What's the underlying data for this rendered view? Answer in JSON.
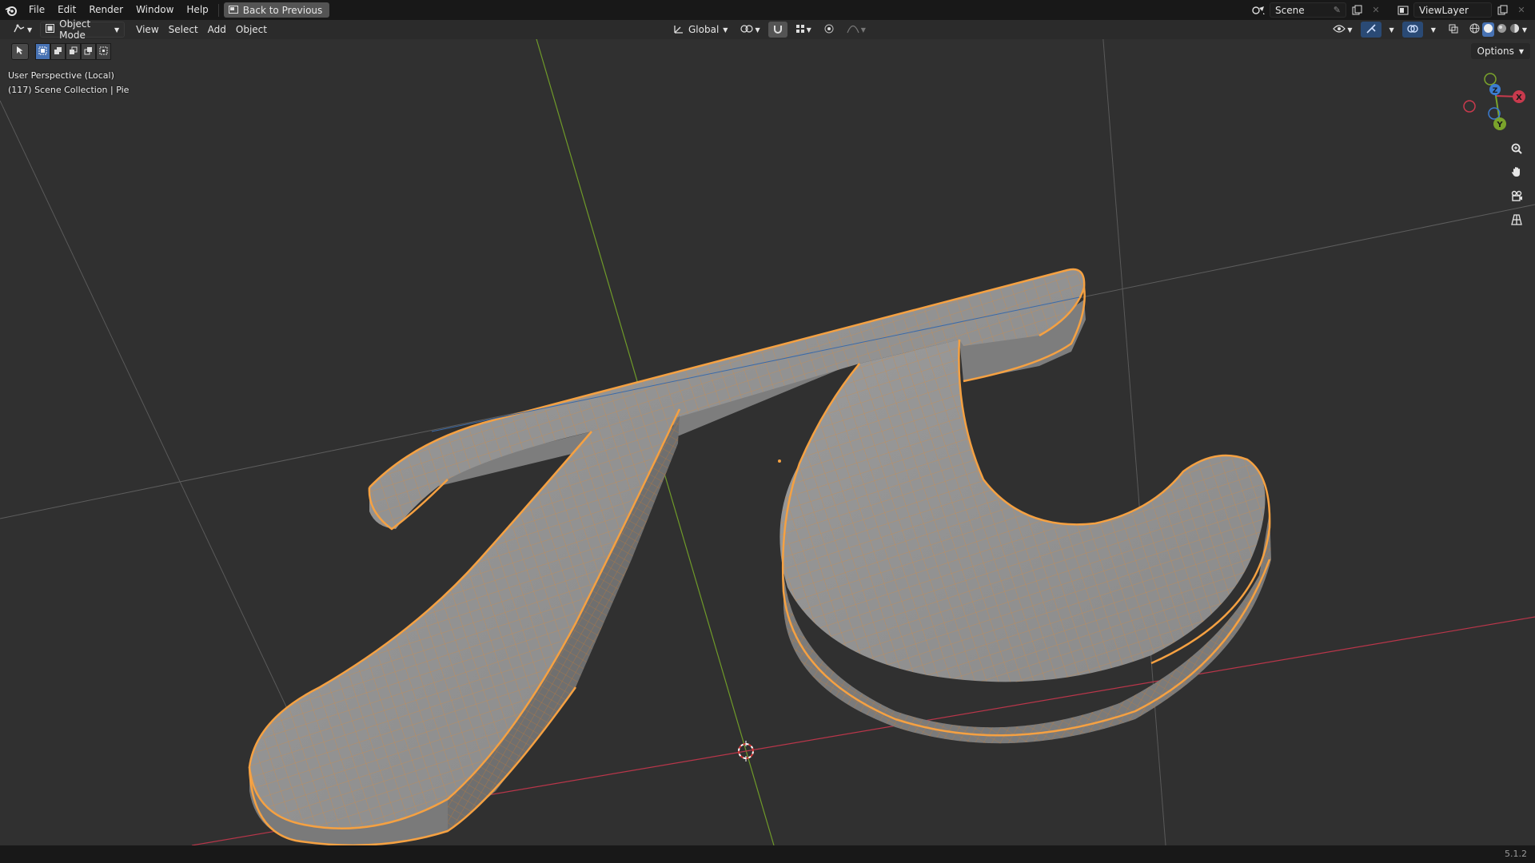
{
  "menu": {
    "items": [
      "File",
      "Edit",
      "Render",
      "Window",
      "Help"
    ],
    "back_button": "Back to Previous"
  },
  "topbar_right": {
    "scene_label": "Scene",
    "view_layer_label": "ViewLayer"
  },
  "header": {
    "mode": "Object Mode",
    "menus": [
      "View",
      "Select",
      "Add",
      "Object"
    ],
    "transform_orientation": "Global"
  },
  "toolbar": {
    "options_label": "Options"
  },
  "viewport": {
    "perspective_label": "User Perspective (Local)",
    "collection_label": "(117) Scene Collection | Pie",
    "gizmo": {
      "x_label": "X",
      "y_label": "Y",
      "z_label": "Z"
    }
  },
  "status": {
    "version": "5.1.2"
  },
  "colors": {
    "accent": "#4772b3",
    "selection_outline": "#f5a142",
    "axis_x": "#c83a4d",
    "axis_y": "#7aa32b",
    "axis_z": "#3b7cd1",
    "grid_background": "#303030"
  }
}
